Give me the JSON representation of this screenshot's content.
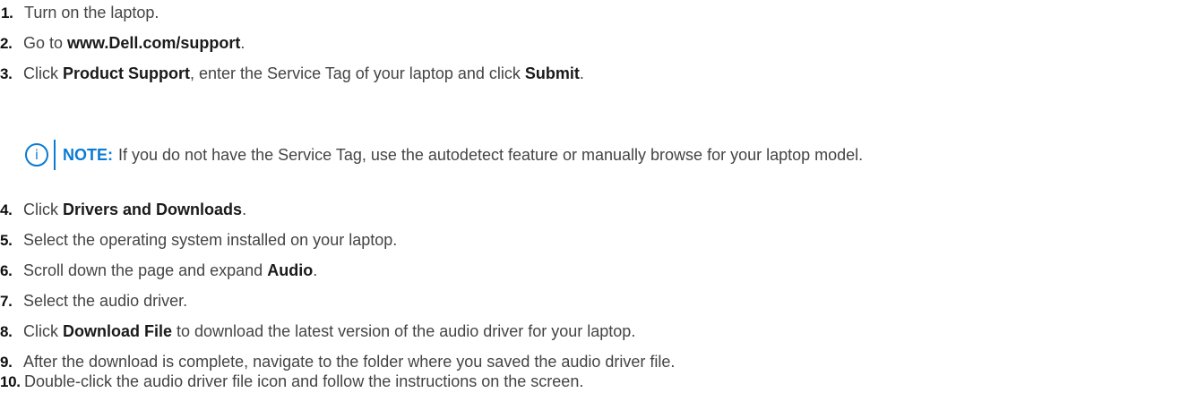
{
  "steps": [
    {
      "number": "1.",
      "parts": [
        "Turn on the laptop."
      ]
    },
    {
      "number": "2.",
      "parts": [
        "Go to ",
        "www.Dell.com/support",
        "."
      ]
    },
    {
      "number": "3.",
      "parts": [
        "Click ",
        "Product Support",
        ", enter the Service Tag of your laptop and click ",
        "Submit",
        "."
      ]
    },
    {
      "number": "4.",
      "parts": [
        "Click ",
        "Drivers and Downloads",
        "."
      ]
    },
    {
      "number": "5.",
      "parts": [
        "Select the operating system installed on your laptop."
      ]
    },
    {
      "number": "6.",
      "parts": [
        "Scroll down the page and expand ",
        "Audio",
        "."
      ]
    },
    {
      "number": "7.",
      "parts": [
        "Select the audio driver."
      ]
    },
    {
      "number": "8.",
      "parts": [
        "Click ",
        "Download File",
        " to download the latest version of the audio driver for your laptop."
      ]
    },
    {
      "number": "9.",
      "parts": [
        "After the download is complete, navigate to the folder where you saved the audio driver file."
      ]
    },
    {
      "number": "10.",
      "parts": [
        "Double-click the audio driver file icon and follow the instructions on the screen."
      ]
    }
  ],
  "note": {
    "icon": "info-icon",
    "icon_glyph": "i",
    "label": "NOTE:",
    "text": "If you do not have the Service Tag, use the autodetect feature or manually browse for your laptop model.",
    "accent_color": "#0a7bd3"
  }
}
